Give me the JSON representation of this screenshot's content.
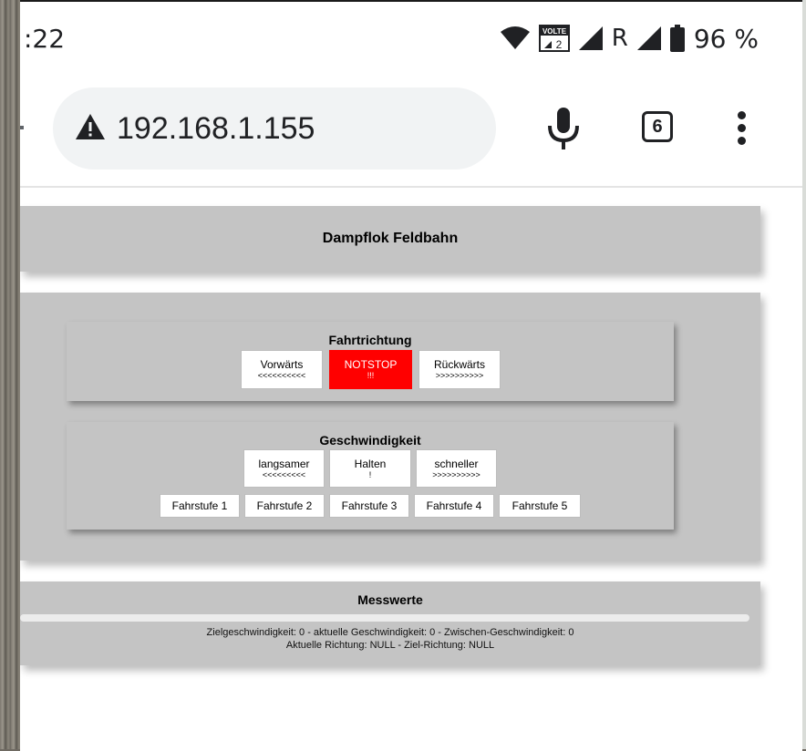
{
  "status_bar": {
    "time": ":22",
    "volte_label": "VOLTE",
    "sim_label": "2",
    "network_label": "R",
    "battery": "96 %"
  },
  "browser": {
    "url": "192.168.1.155",
    "tab_count": "6"
  },
  "page": {
    "title": "Dampflok Feldbahn",
    "direction": {
      "heading": "Fahrtrichtung",
      "buttons": [
        {
          "line1": "Vorwärts",
          "line2": "<<<<<<<<<<"
        },
        {
          "line1": "NOTSTOP",
          "line2": "!!!"
        },
        {
          "line1": "Rückwärts",
          "line2": ">>>>>>>>>>"
        }
      ]
    },
    "speed": {
      "heading": "Geschwindigkeit",
      "buttons": [
        {
          "line1": "langsamer",
          "line2": "<<<<<<<<<"
        },
        {
          "line1": "Halten",
          "line2": "!"
        },
        {
          "line1": "schneller",
          "line2": ">>>>>>>>>>"
        }
      ],
      "steps": [
        "Fahrstufe 1",
        "Fahrstufe 2",
        "Fahrstufe 3",
        "Fahrstufe 4",
        "Fahrstufe 5"
      ]
    },
    "measurements": {
      "heading": "Messwerte",
      "progress": 0,
      "line1": "Zielgeschwindigkeit: 0 - aktuelle Geschwindigkeit: 0 - Zwischen-Geschwindigkeit: 0",
      "line2": "Aktuelle Richtung: NULL - Ziel-Richtung: NULL"
    }
  },
  "colors": {
    "panel": "#c4c4c4",
    "notstop": "#ff0000",
    "omnibox": "#f1f3f4"
  },
  "icons": [
    "wifi-icon",
    "volte-icon",
    "signal-icon",
    "battery-icon",
    "warning-icon",
    "mic-icon",
    "tabs-icon",
    "menu-icon"
  ]
}
